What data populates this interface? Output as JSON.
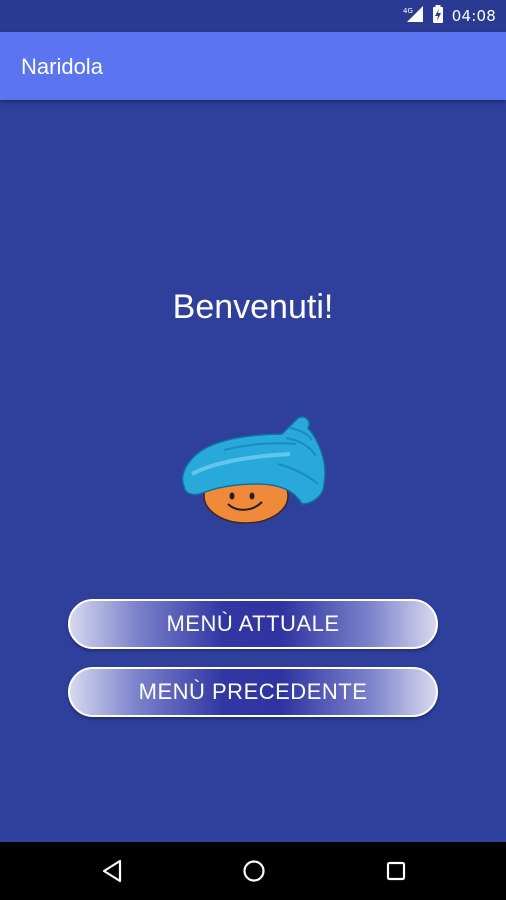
{
  "status_bar": {
    "network_label": "4G",
    "time": "04:08"
  },
  "app_bar": {
    "title": "Naridola"
  },
  "main": {
    "welcome_text": "Benvenuti!",
    "mascot_icon": "smiling-shell-hat-mascot",
    "buttons": {
      "current_menu": "MENÙ ATTUALE",
      "previous_menu": "MENÙ PRECEDENTE"
    }
  },
  "nav_bar": {
    "icons": [
      "back-icon",
      "home-icon",
      "recents-icon"
    ]
  },
  "colors": {
    "background": "#2f3f9c",
    "app_bar": "#5a74f2",
    "status_bar": "#2a3991",
    "hat": "#29a8dc",
    "face": "#f08a3a"
  }
}
